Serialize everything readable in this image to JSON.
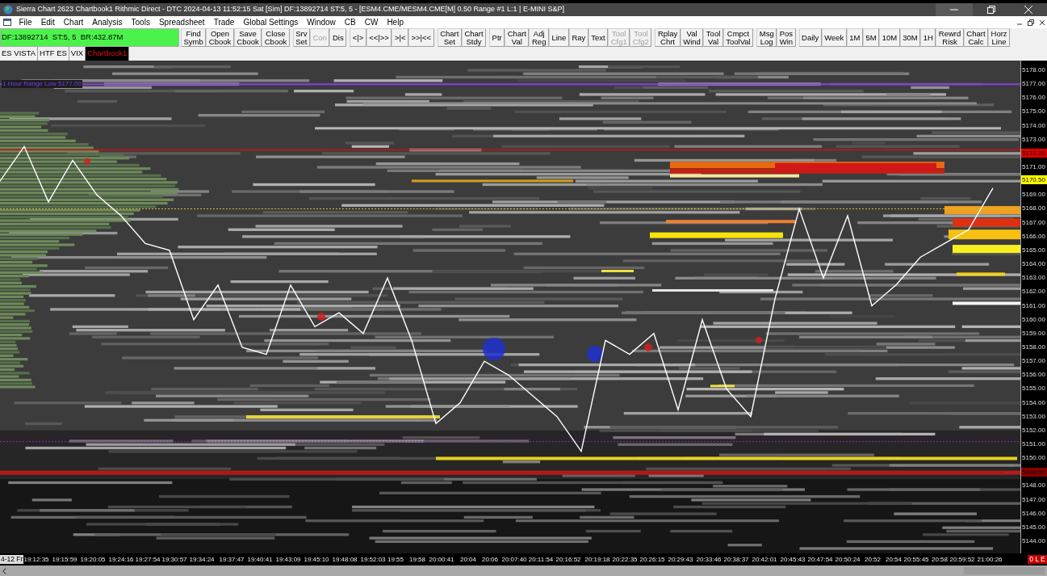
{
  "window": {
    "title": "Sierra Chart 2623 Chartbook1 Rithmic Direct - DTC 2024-04-13  11:52:15 Sat [Sim] DF:13892714  ST:5, 5 - [ESM4.CME/MESM4.CME[M]  0.50 Range #1 L:1 | E-MINI S&P]"
  },
  "menu": [
    "File",
    "Edit",
    "Chart",
    "Analysis",
    "Tools",
    "Spreadsheet",
    "Trade",
    "Global Settings",
    "Window",
    "CB",
    "CW",
    "Help"
  ],
  "status_field": "DF:13892714  ST:5, 5  BR:432.87M",
  "toolbar": [
    {
      "label": "Find\nSymb",
      "disabled": false
    },
    {
      "label": "Open\nCbook",
      "disabled": false
    },
    {
      "label": "Save\nCbook",
      "disabled": false
    },
    {
      "label": "Close\nCbook",
      "disabled": false
    },
    {
      "label": "Srv\nSet",
      "disabled": false
    },
    {
      "label": "Con",
      "disabled": true
    },
    {
      "label": "Dis",
      "disabled": false
    },
    {
      "label": "<|>",
      "disabled": false
    },
    {
      "label": "<<|>>",
      "disabled": false
    },
    {
      "label": ">|<",
      "disabled": false
    },
    {
      "label": ">>|<<",
      "disabled": false
    },
    {
      "label": "Chart\nSet",
      "disabled": false
    },
    {
      "label": "Chart\nStdy",
      "disabled": false
    },
    {
      "label": "Ptr",
      "disabled": false
    },
    {
      "label": "Chart\nVal",
      "disabled": false
    },
    {
      "label": "Adj\nReg",
      "disabled": false
    },
    {
      "label": "Line",
      "disabled": false
    },
    {
      "label": "Ray",
      "disabled": false
    },
    {
      "label": "Text",
      "disabled": false
    },
    {
      "label": "Tool\nCfg1",
      "disabled": true
    },
    {
      "label": "Tool\nCfg2",
      "disabled": true
    },
    {
      "label": "Rplay\nChrt",
      "disabled": false
    },
    {
      "label": "Val\nWind",
      "disabled": false
    },
    {
      "label": "Tool\nVal",
      "disabled": false
    },
    {
      "label": "Cmpct\nToolVal",
      "disabled": false
    },
    {
      "label": "Msg\nLog",
      "disabled": false
    },
    {
      "label": "Pos\nWin",
      "disabled": false
    },
    {
      "label": "Daily",
      "disabled": false
    },
    {
      "label": "Week",
      "disabled": false
    },
    {
      "label": "1M",
      "disabled": false
    },
    {
      "label": "5M",
      "disabled": false
    },
    {
      "label": "10M",
      "disabled": false
    },
    {
      "label": "30M",
      "disabled": false
    },
    {
      "label": "1H",
      "disabled": false
    },
    {
      "label": "Rewrd\nRisk",
      "disabled": false
    },
    {
      "label": "Chart\nCalc",
      "disabled": false
    },
    {
      "label": "Horz\nLine",
      "disabled": false
    }
  ],
  "tabs": [
    {
      "label": "ES VISTA",
      "selected": false
    },
    {
      "label": "HTF ES",
      "selected": false
    },
    {
      "label": "VIX",
      "selected": false
    },
    {
      "label": "Chartbook1",
      "selected": true
    }
  ],
  "chart": {
    "range_label": "1 Hour Range Low  5177.00",
    "price_markers": [
      {
        "text": "5172.25",
        "color": "#e00000"
      },
      {
        "text": "5170.50",
        "color": "#ffff00"
      },
      {
        "text": "5149.00",
        "color": "#8b0000"
      }
    ],
    "time_start": "4-12 Fr",
    "time_axis": [
      "19:12:35",
      "19:15:59",
      "19:20:05",
      "19:24:16",
      "19:27:54",
      "19:30:57",
      "19:34:24",
      "19:37:47",
      "19:40:41",
      "19:43:09",
      "19:45:10",
      "19:48:08",
      "19:52:03",
      "19:55",
      "19:58",
      "20:00:41",
      "20:04",
      "20:06",
      "20:07:40",
      "20:11:54",
      "20:16:52",
      "20:19:18",
      "20:22:35",
      "20:26:15",
      "20:29:43",
      "20:33:46",
      "20:38:37",
      "20:42:01",
      "20:45:43",
      "20:47:54",
      "20:50:24",
      "20:52",
      "20:54",
      "20:55:45",
      "20:58",
      "20:59:52",
      "21:00:26"
    ],
    "corner_badge": "0 L E",
    "chart_data": {
      "type": "line",
      "ylim": [
        5143.13,
        5178.7
      ],
      "yticks": [
        {
          "value": 5178,
          "label": "5178.00"
        },
        {
          "value": 5177,
          "label": "5177.00"
        },
        {
          "value": 5176,
          "label": "5176.00"
        },
        {
          "value": 5175,
          "label": "5175.00"
        },
        {
          "value": 5174,
          "label": "5174.00"
        },
        {
          "value": 5173,
          "label": "5173.00"
        },
        {
          "value": 5171,
          "label": "5171.00"
        },
        {
          "value": 5169,
          "label": "5169.00"
        },
        {
          "value": 5168,
          "label": "5168.00"
        },
        {
          "value": 5167,
          "label": "5167.00"
        },
        {
          "value": 5166,
          "label": "5166.00"
        },
        {
          "value": 5165,
          "label": "5165.00"
        },
        {
          "value": 5164,
          "label": "5164.00"
        },
        {
          "value": 5163,
          "label": "5163.00"
        },
        {
          "value": 5162,
          "label": "5162.00"
        },
        {
          "value": 5161,
          "label": "5161.00"
        },
        {
          "value": 5160,
          "label": "5160.00"
        },
        {
          "value": 5159,
          "label": "5159.00"
        },
        {
          "value": 5158,
          "label": "5158.00"
        },
        {
          "value": 5157,
          "label": "5157.00"
        },
        {
          "value": 5156,
          "label": "5156.00"
        },
        {
          "value": 5155,
          "label": "5155.00"
        },
        {
          "value": 5154,
          "label": "5154.00"
        },
        {
          "value": 5153,
          "label": "5153.00"
        },
        {
          "value": 5152,
          "label": "5152.00"
        },
        {
          "value": 5151,
          "label": "5151.00"
        },
        {
          "value": 5150,
          "label": "5150.00"
        },
        {
          "value": 5148,
          "label": "5148.00"
        },
        {
          "value": 5147,
          "label": "5147.00"
        },
        {
          "value": 5146,
          "label": "5146.00"
        },
        {
          "value": 5145,
          "label": "5145.00"
        },
        {
          "value": 5144,
          "label": "5144.00"
        }
      ],
      "series": [
        {
          "color": "#ffffff",
          "values": [
            5170,
            5172.5,
            5168.5,
            5171.5,
            5169,
            5167.5,
            5165.5,
            5165,
            5160,
            5162.5,
            5158,
            5157.5,
            5162.5,
            5159.5,
            5160.5,
            5159,
            5163,
            5158.5,
            5152.5,
            5154,
            5157,
            5156,
            5154.5,
            5153,
            5150.5,
            5158.5,
            5157.5,
            5159,
            5153.5,
            5160,
            5155,
            5153,
            5161.5,
            5168,
            5163,
            5167.5,
            5161,
            5162.5,
            5164.5,
            5165.5,
            5166.5,
            5169.5
          ]
        }
      ]
    }
  }
}
